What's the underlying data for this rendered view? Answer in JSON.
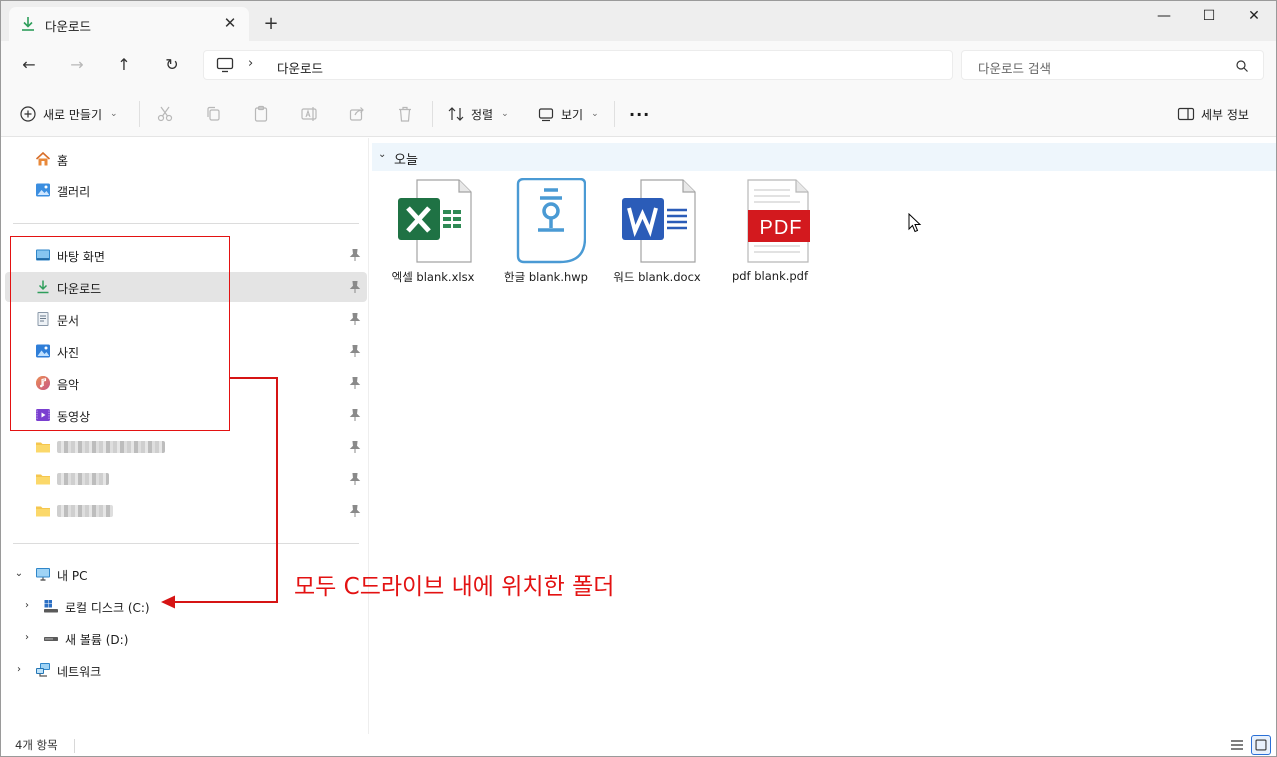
{
  "window": {
    "tab_title": "다운로드",
    "new_tab_symbol": "+",
    "close_tab_symbol": "✕",
    "minimize_symbol": "—",
    "maximize_symbol": "☐",
    "close_symbol": "✕"
  },
  "nav": {
    "back_symbol": "←",
    "forward_symbol": "→",
    "up_symbol": "↑",
    "refresh_symbol": "↻",
    "path_separator": "›",
    "path": "다운로드",
    "search_placeholder": "다운로드 검색"
  },
  "toolbar": {
    "new_label": "새로 만들기",
    "sort_label": "정렬",
    "view_label": "보기",
    "more_symbol": "···",
    "details_label": "세부 정보"
  },
  "sidebar": {
    "top": [
      {
        "label": "홈",
        "icon": "home-icon"
      },
      {
        "label": "갤러리",
        "icon": "gallery-icon"
      }
    ],
    "quick_access": [
      {
        "label": "바탕 화면",
        "icon": "desktop-icon"
      },
      {
        "label": "다운로드",
        "icon": "download-icon"
      },
      {
        "label": "문서",
        "icon": "document-icon"
      },
      {
        "label": "사진",
        "icon": "picture-icon"
      },
      {
        "label": "음악",
        "icon": "music-icon"
      },
      {
        "label": "동영상",
        "icon": "video-icon"
      }
    ],
    "this_pc": {
      "label": "내 PC",
      "drives": [
        {
          "label": "로컬 디스크 (C:)",
          "icon": "drive-c-icon"
        },
        {
          "label": "새 볼륨 (D:)",
          "icon": "drive-d-icon"
        }
      ]
    },
    "network_label": "네트워크"
  },
  "content": {
    "group_title": "오늘",
    "files": [
      {
        "name": "엑셀 blank.xlsx",
        "icon": "excel-file-icon",
        "color": "#1f7244"
      },
      {
        "name": "한글 blank.hwp",
        "icon": "hwp-file-icon",
        "color": "#4a9ad4"
      },
      {
        "name": "워드 blank.docx",
        "icon": "word-file-icon",
        "color": "#2b5cb8"
      },
      {
        "name": "pdf blank.pdf",
        "icon": "pdf-file-icon",
        "color": "#d3191e"
      }
    ]
  },
  "status": {
    "item_count": "4개 항목"
  },
  "annotation": {
    "text": "모두 C드라이브 내에 위치한 폴더",
    "color": "#e31212"
  }
}
